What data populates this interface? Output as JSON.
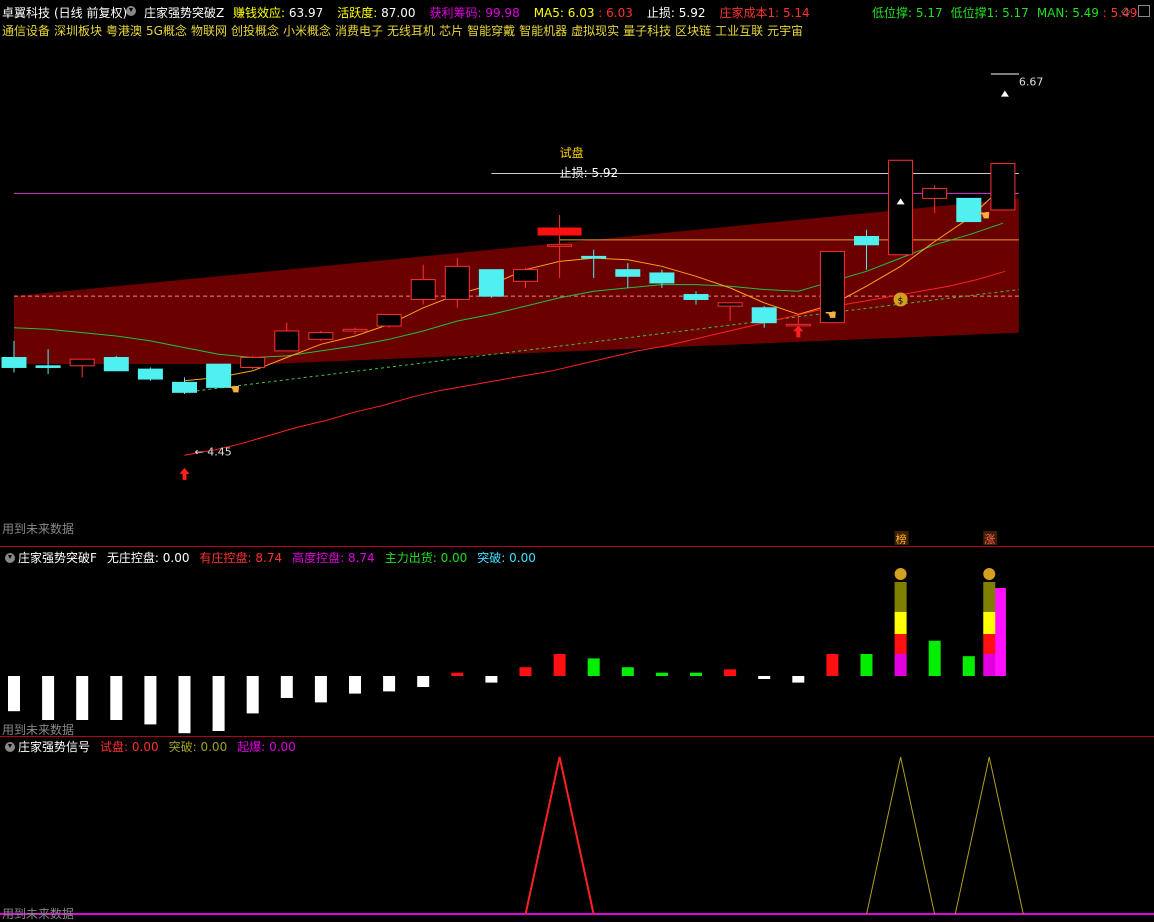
{
  "header": {
    "stock_name": "卓翼科技",
    "period": "(日线 前复权)",
    "indicator": "庄家强势突破Z",
    "items": [
      {
        "label": "赚钱效应",
        "value": "63.97",
        "label_color": "#ffff00",
        "value_color": "#ffffff"
      },
      {
        "label": "活跃度",
        "value": "87.00",
        "label_color": "#ffff00",
        "value_color": "#ffffff"
      },
      {
        "label": "获利筹码",
        "value": "99.98",
        "label_color": "#e000e0",
        "value_color": "#e000e0"
      },
      {
        "label": "MA5",
        "value": "6.03",
        "extra": "6.03",
        "label_color": "#ffff00",
        "value_color": "#ffff00",
        "extra_color": "#ff3030"
      },
      {
        "label": "止损",
        "value": "5.92",
        "label_color": "#ffffff",
        "value_color": "#ffffff"
      },
      {
        "label": "庄家成本1",
        "value": "5.14",
        "label_color": "#ff3030",
        "value_color": "#ff3030"
      }
    ],
    "right_items": [
      {
        "label": "低位撑",
        "value": "5.17",
        "color": "#22dd22"
      },
      {
        "label": "低位撑1",
        "value": "5.17",
        "color": "#22dd22"
      },
      {
        "label": "MAN",
        "value": "5.49",
        "extra": "5.49",
        "color": "#22dd22",
        "extra_color": "#ff3030"
      }
    ]
  },
  "concepts": [
    "通信设备",
    "深圳板块",
    "粤港澳",
    "5G概念",
    "物联网",
    "创投概念",
    "小米概念",
    "消费电子",
    "无线耳机",
    "芯片",
    "智能穿戴",
    "智能机器",
    "虚拟现实",
    "量子科技",
    "区块链",
    "工业互联",
    "元宇宙"
  ],
  "main_chart": {
    "annotations": {
      "high_label": "6.67",
      "low_label": "4.45",
      "trial_label": "试盘",
      "stoploss_label": "止损: 5.92"
    },
    "markers": {
      "bang": "榜",
      "zhang": "涨"
    },
    "footer_note": "用到未来数据"
  },
  "panel2": {
    "title": "庄家强势突破F",
    "items": [
      {
        "label": "无庄控盘",
        "value": "0.00",
        "color": "#ffffff"
      },
      {
        "label": "有庄控盘",
        "value": "8.74",
        "color": "#ff3030"
      },
      {
        "label": "高度控盘",
        "value": "8.74",
        "color": "#e000e0"
      },
      {
        "label": "主力出货",
        "value": "0.00",
        "color": "#22dd22"
      },
      {
        "label": "突破",
        "value": "0.00",
        "color": "#40e0ff"
      }
    ],
    "footer_note": "用到未来数据"
  },
  "panel3": {
    "title": "庄家强势信号",
    "items": [
      {
        "label": "试盘",
        "value": "0.00",
        "color": "#ff3030"
      },
      {
        "label": "突破",
        "value": "0.00",
        "color": "#a0a020"
      },
      {
        "label": "起爆",
        "value": "0.00",
        "color": "#e000e0"
      }
    ],
    "footer_note": "用到未来数据"
  },
  "chart_data": {
    "type": "candlestick",
    "candles": [
      {
        "o": 5.02,
        "h": 5.12,
        "l": 4.93,
        "c": 4.96,
        "color": "cyan"
      },
      {
        "o": 4.97,
        "h": 5.07,
        "l": 4.92,
        "c": 4.96,
        "color": "cyan"
      },
      {
        "o": 4.97,
        "h": 5.0,
        "l": 4.9,
        "c": 5.01,
        "color": "red"
      },
      {
        "o": 5.02,
        "h": 5.03,
        "l": 4.94,
        "c": 4.94,
        "color": "cyan"
      },
      {
        "o": 4.95,
        "h": 4.96,
        "l": 4.88,
        "c": 4.89,
        "color": "cyan"
      },
      {
        "o": 4.87,
        "h": 4.9,
        "l": 4.8,
        "c": 4.81,
        "color": "cyan"
      },
      {
        "o": 4.84,
        "h": 4.98,
        "l": 4.84,
        "c": 4.98,
        "color": "cyan"
      },
      {
        "o": 4.96,
        "h": 5.03,
        "l": 4.95,
        "c": 5.02,
        "color": "red"
      },
      {
        "o": 5.06,
        "h": 5.23,
        "l": 5.06,
        "c": 5.18,
        "color": "red"
      },
      {
        "o": 5.13,
        "h": 5.18,
        "l": 5.12,
        "c": 5.17,
        "color": "red"
      },
      {
        "o": 5.18,
        "h": 5.2,
        "l": 5.16,
        "c": 5.19,
        "color": "red"
      },
      {
        "o": 5.21,
        "h": 5.28,
        "l": 5.2,
        "c": 5.28,
        "color": "red"
      },
      {
        "o": 5.37,
        "h": 5.58,
        "l": 5.34,
        "c": 5.49,
        "color": "red"
      },
      {
        "o": 5.37,
        "h": 5.62,
        "l": 5.32,
        "c": 5.57,
        "color": "red"
      },
      {
        "o": 5.55,
        "h": 5.55,
        "l": 5.38,
        "c": 5.39,
        "color": "cyan"
      },
      {
        "o": 5.48,
        "h": 5.56,
        "l": 5.44,
        "c": 5.55,
        "color": "red"
      },
      {
        "o": 5.7,
        "h": 5.88,
        "l": 5.5,
        "c": 5.7,
        "color": "red"
      },
      {
        "o": 5.63,
        "h": 5.67,
        "l": 5.5,
        "c": 5.62,
        "color": "cyan"
      },
      {
        "o": 5.55,
        "h": 5.59,
        "l": 5.44,
        "c": 5.51,
        "color": "cyan"
      },
      {
        "o": 5.53,
        "h": 5.55,
        "l": 5.44,
        "c": 5.47,
        "color": "cyan"
      },
      {
        "o": 5.4,
        "h": 5.42,
        "l": 5.34,
        "c": 5.37,
        "color": "cyan"
      },
      {
        "o": 5.35,
        "h": 5.35,
        "l": 5.24,
        "c": 5.33,
        "color": "red"
      },
      {
        "o": 5.32,
        "h": 5.33,
        "l": 5.2,
        "c": 5.23,
        "color": "cyan"
      },
      {
        "o": 5.22,
        "h": 5.28,
        "l": 5.22,
        "c": 5.22,
        "color": "red"
      },
      {
        "o": 5.23,
        "h": 5.66,
        "l": 5.23,
        "c": 5.66,
        "color": "red"
      },
      {
        "o": 5.7,
        "h": 5.79,
        "l": 5.55,
        "c": 5.75,
        "color": "cyan"
      },
      {
        "o": 5.64,
        "h": 6.21,
        "l": 5.64,
        "c": 6.21,
        "color": "red"
      },
      {
        "o": 5.98,
        "h": 6.06,
        "l": 5.89,
        "c": 6.04,
        "color": "red"
      },
      {
        "o": 5.98,
        "h": 5.98,
        "l": 5.84,
        "c": 5.84,
        "color": "cyan"
      },
      {
        "o": 5.91,
        "h": 6.19,
        "l": 5.91,
        "c": 6.19,
        "color": "red"
      }
    ],
    "panel2_bars": [
      -1.6,
      -2.0,
      -2.0,
      -2.0,
      -2.2,
      -2.6,
      -2.5,
      -1.7,
      -1.0,
      -1.2,
      -0.8,
      -0.7,
      -0.5,
      0.15,
      -0.3,
      0.4,
      1.0,
      0.8,
      0.4,
      0.15,
      0.15,
      0.3,
      -0.12,
      -0.3,
      1.0,
      1.0,
      4.0,
      1.6,
      0.9,
      4.0
    ],
    "panel2_colors": [
      "#ffffff",
      "#ffffff",
      "#ffffff",
      "#ffffff",
      "#ffffff",
      "#ffffff",
      "#ffffff",
      "#ffffff",
      "#ffffff",
      "#ffffff",
      "#ffffff",
      "#ffffff",
      "#ffffff",
      "#ff1010",
      "#ffffff",
      "#ff1010",
      "#ff1010",
      "#00ee00",
      "#00ee00",
      "#00ee00",
      "#00ee00",
      "#ff1010",
      "#ffffff",
      "#ffffff",
      "#ff1010",
      "#00ee00",
      "stack",
      "#00ee00",
      "#00ee00",
      "#ff10ff"
    ],
    "panel3_peaks": [
      {
        "index": 16,
        "color": "#ff2020"
      },
      {
        "index": 26,
        "color": "#b0a020"
      },
      {
        "index": 29,
        "color": "#b0a020"
      }
    ]
  }
}
